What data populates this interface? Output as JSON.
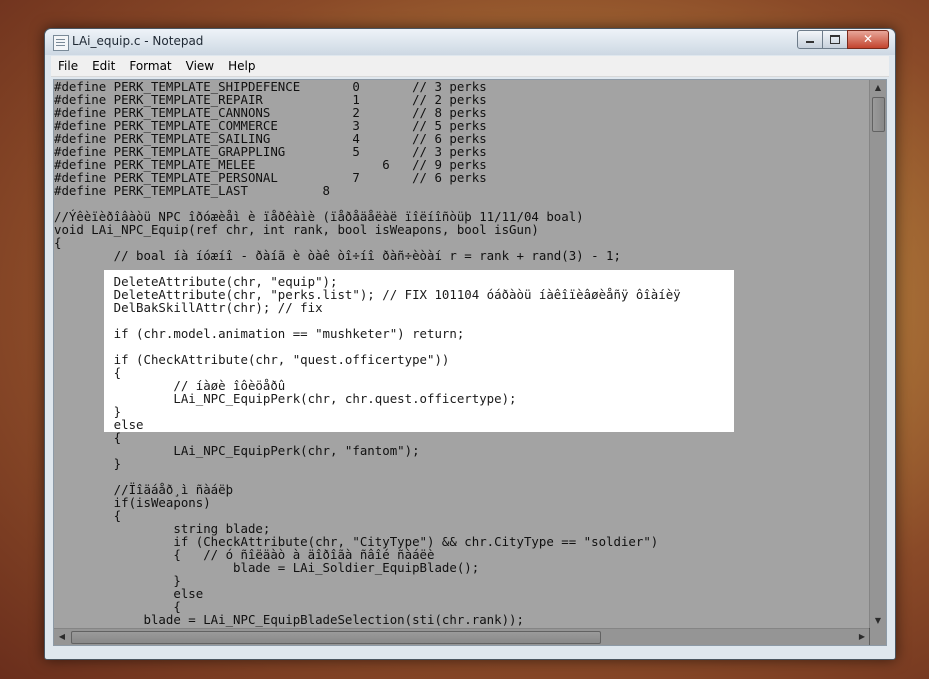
{
  "window": {
    "title": "LAi_equip.c - Notepad",
    "close_glyph": "✕"
  },
  "menu": [
    "File",
    "Edit",
    "Format",
    "View",
    "Help"
  ],
  "icons": {
    "scroll_up": "▲",
    "scroll_down": "▼",
    "scroll_left": "◀",
    "scroll_right": "▶"
  },
  "code_lines": [
    "#define PERK_TEMPLATE_SHIPDEFENCE       0       // 3 perks",
    "#define PERK_TEMPLATE_REPAIR            1       // 2 perks",
    "#define PERK_TEMPLATE_CANNONS           2       // 8 perks",
    "#define PERK_TEMPLATE_COMMERCE          3       // 5 perks",
    "#define PERK_TEMPLATE_SAILING           4       // 6 perks",
    "#define PERK_TEMPLATE_GRAPPLING         5       // 3 perks",
    "#define PERK_TEMPLATE_MELEE                 6   // 9 perks",
    "#define PERK_TEMPLATE_PERSONAL          7       // 6 perks",
    "#define PERK_TEMPLATE_LAST          8",
    "",
    "//Ýêèïèðîâàòü NPC îðóæèåì è ïåðêàìè (ïåðåäåëàë ïîëíîñòüþ 11/11/04 boal)",
    "void LAi_NPC_Equip(ref chr, int rank, bool isWeapons, bool isGun)",
    "{",
    "        // boal íà íóæíî - ðàíã è òàê òî÷íî ðàñ÷èòàí r = rank + rand(3) - 1;",
    "",
    "        DeleteAttribute(chr, \"equip\");",
    "        DeleteAttribute(chr, \"perks.list\"); // FIX 101104 óáðàòü íàêîïèâøèåñÿ ôîàíèÿ",
    "        DelBakSkillAttr(chr); // fix",
    "",
    "        if (chr.model.animation == \"mushketer\") return;",
    "",
    "        if (CheckAttribute(chr, \"quest.officertype\"))",
    "        {",
    "                // íàøè îôèöåðû",
    "                LAi_NPC_EquipPerk(chr, chr.quest.officertype);",
    "        }",
    "        else",
    "        {",
    "                LAi_NPC_EquipPerk(chr, \"fantom\");",
    "        }",
    "",
    "        //Ïîäáåð¸ì ñàáëþ",
    "        if(isWeapons)",
    "        {",
    "                string blade;",
    "                if (CheckAttribute(chr, \"CityType\") && chr.CityType == \"soldier\")",
    "                {   // ó ñîëäàò à äîðîãà ñâîé ñàáëè",
    "                        blade = LAi_Soldier_EquipBlade();",
    "                }",
    "                else",
    "                {",
    "            blade = LAi_NPC_EquipBladeSelection(sti(chr.rank));"
  ]
}
